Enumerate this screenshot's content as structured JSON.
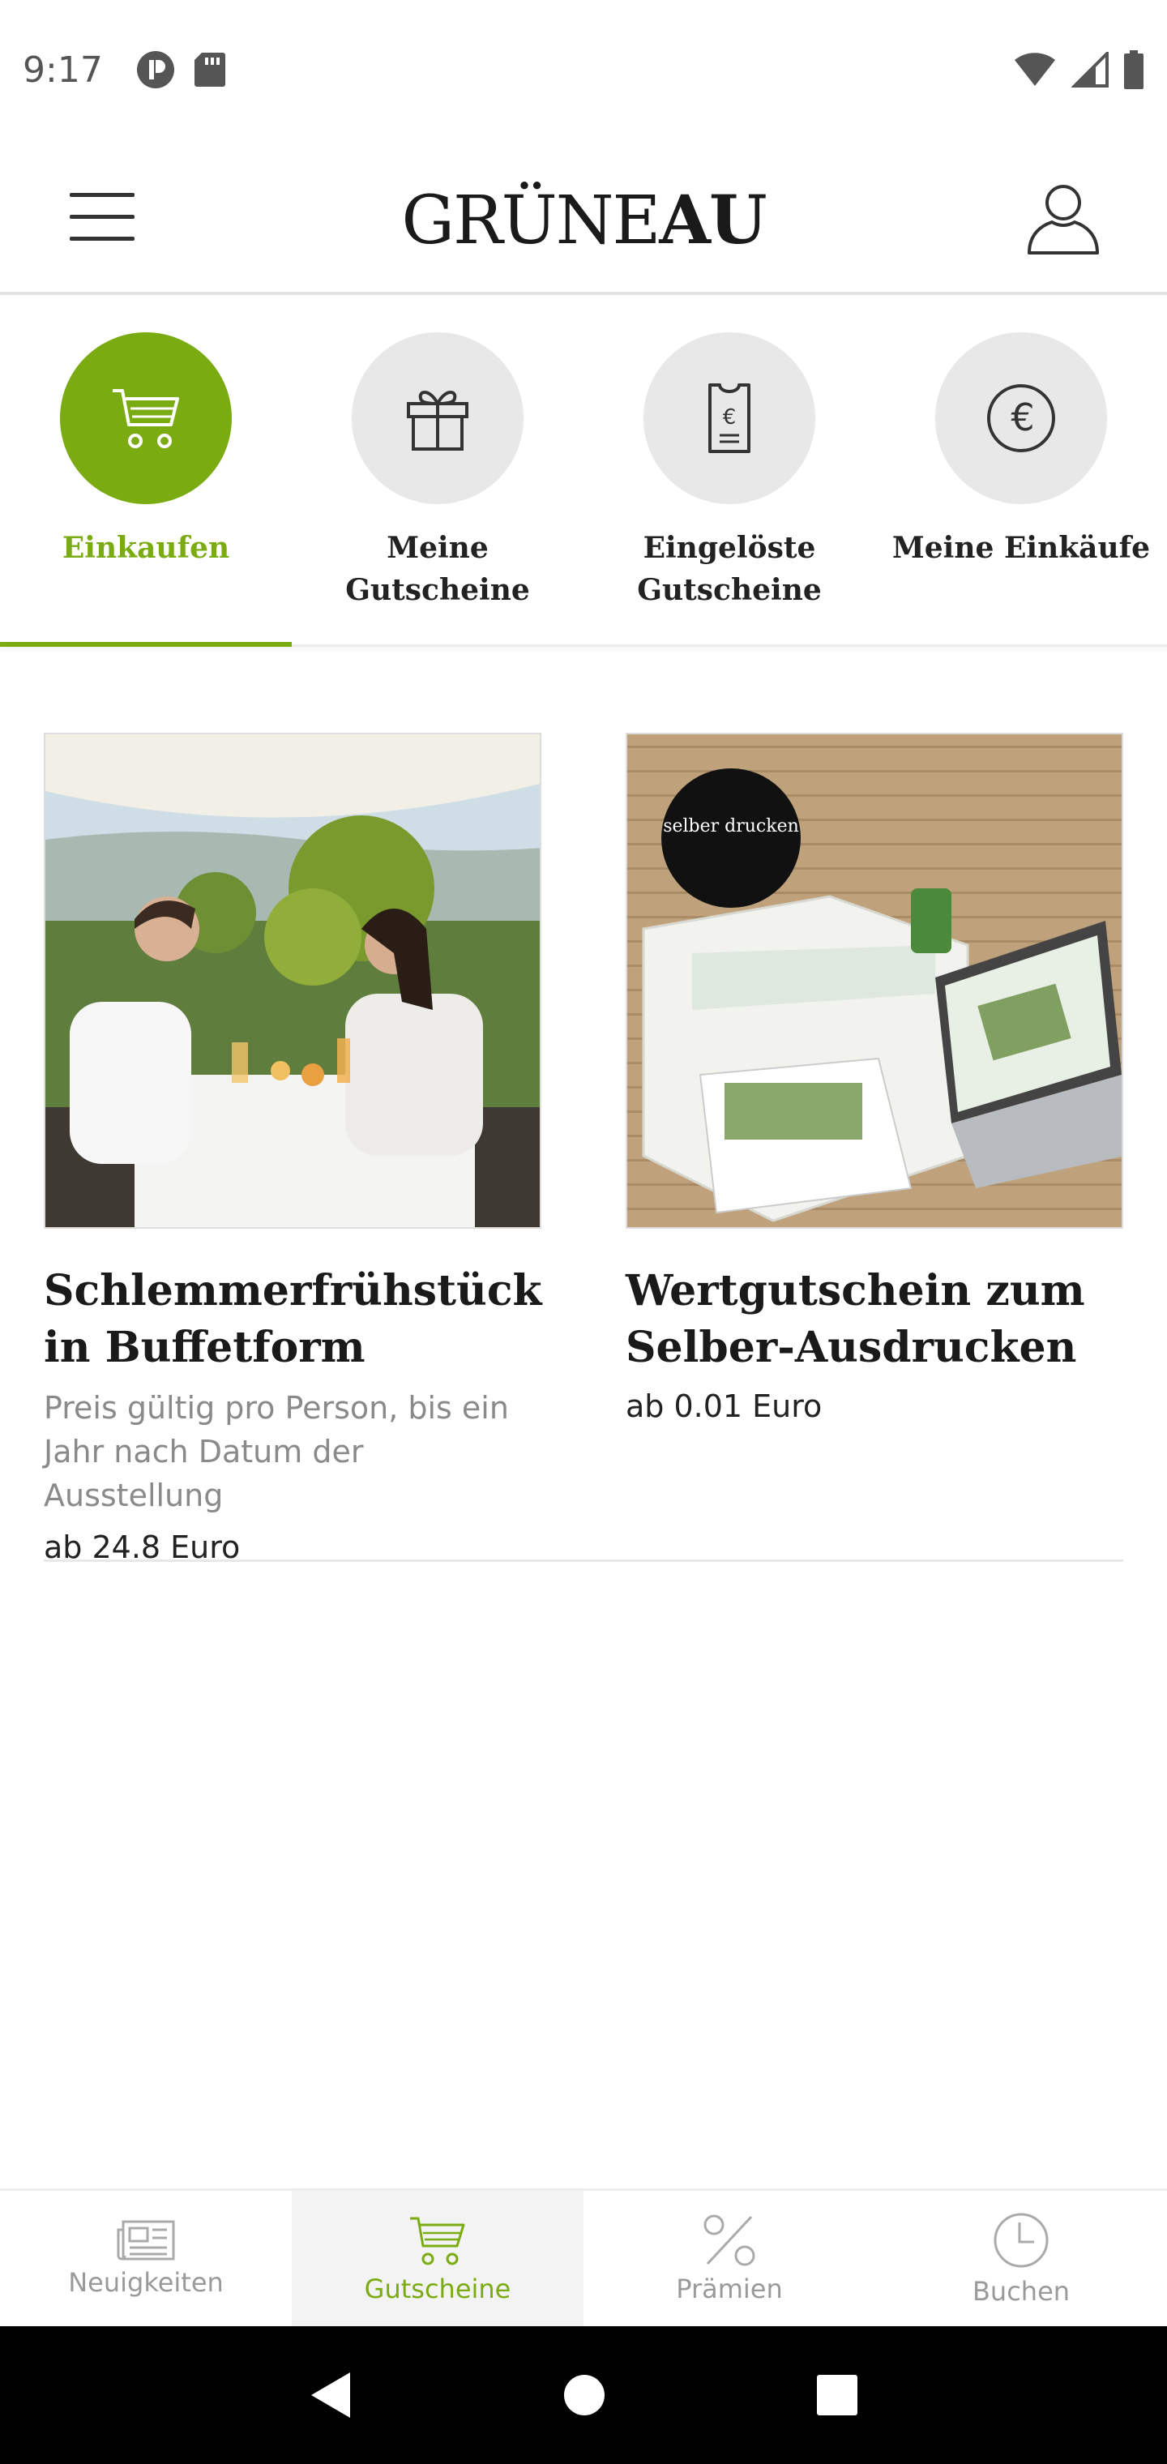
{
  "status_bar": {
    "time": "9:17",
    "left_icons": [
      "app-notification-icon",
      "sd-card-icon"
    ],
    "right_icons": [
      "wifi-icon",
      "cell-signal-icon",
      "battery-icon"
    ]
  },
  "header": {
    "brand_light": "GRÜNE",
    "brand_bold": "AU",
    "menu_icon": "hamburger-menu-icon",
    "profile_icon": "user-profile-icon"
  },
  "category_tabs": [
    {
      "label": "Einkaufen",
      "icon": "shopping-cart-icon",
      "active": true
    },
    {
      "label": "Meine Gutscheine",
      "icon": "gift-icon",
      "active": false
    },
    {
      "label": "Eingelöste Gutscheine",
      "icon": "receipt-euro-icon",
      "active": false
    },
    {
      "label": "Meine Einkäufe",
      "icon": "euro-icon",
      "active": false
    }
  ],
  "products": [
    {
      "title": "Schlemmerfrühstück in Buffetform",
      "description": "Preis gültig pro Person, bis ein Jahr nach Datum der Ausstellung",
      "price": "ab 24.8 Euro",
      "image": "breakfast-couple-photo"
    },
    {
      "title": "Wertgutschein zum Selber-Ausdrucken",
      "description": "",
      "price": "ab 0.01 Euro",
      "image": "print-voucher-photo",
      "image_badge": "selber drucken"
    }
  ],
  "bottom_nav": [
    {
      "label": "Neuigkeiten",
      "icon": "newspaper-icon",
      "active": false
    },
    {
      "label": "Gutscheine",
      "icon": "shopping-cart-icon",
      "active": true
    },
    {
      "label": "Prämien",
      "icon": "percent-icon",
      "active": false
    },
    {
      "label": "Buchen",
      "icon": "clock-icon",
      "active": false
    }
  ],
  "colors": {
    "accent": "#7aab11",
    "inactive_circle": "#e8e8e8",
    "inactive_text": "#9a9a9a"
  }
}
